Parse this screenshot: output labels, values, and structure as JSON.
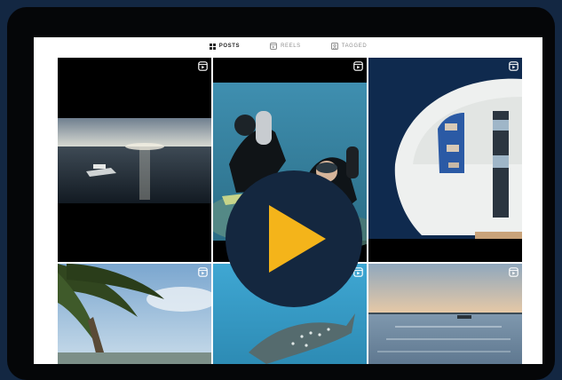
{
  "profile_tabs": [
    {
      "label": "POSTS",
      "icon": "grid-icon",
      "active": true
    },
    {
      "label": "REELS",
      "icon": "reels-icon",
      "active": false
    },
    {
      "label": "TAGGED",
      "icon": "tag-icon",
      "active": false
    }
  ],
  "grid_posts": [
    {
      "subject": "yacht at sea during sunset",
      "icon": "reel-icon"
    },
    {
      "subject": "scuba divers underwater",
      "icon": "reel-icon"
    },
    {
      "subject": "aerial view of yacht deck",
      "icon": "reel-icon"
    },
    {
      "subject": "palm tree and beach",
      "icon": "reel-icon"
    },
    {
      "subject": "whale shark underwater",
      "icon": "reel-icon"
    },
    {
      "subject": "calm lagoon at dusk",
      "icon": "reel-icon"
    }
  ],
  "video_overlay": {
    "icon": "play-icon",
    "color": "#f4b41a",
    "background": "#14273f"
  },
  "theme": {
    "page_background": "#132742",
    "device_frame": "#050608",
    "accent": "#f4b41a"
  }
}
